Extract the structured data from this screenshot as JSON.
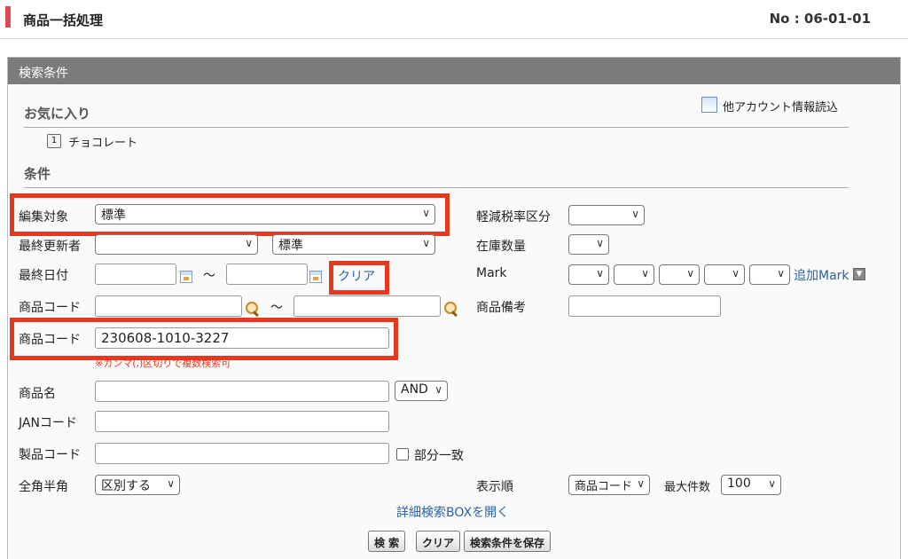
{
  "header": {
    "title": "商品一括処理",
    "page_no": "No : 06-01-01"
  },
  "panel": {
    "title": "検索条件",
    "favorites": {
      "heading": "お気に入り",
      "other_account_link": "他アカウント情報読込",
      "item_badge": "1",
      "item_label": "チョコレート"
    },
    "conditions_heading": "条件",
    "fields": {
      "edit_target": {
        "label": "編集対象",
        "value": "標準"
      },
      "last_updater": {
        "label": "最終更新者",
        "value": "",
        "value2": "標準"
      },
      "last_date": {
        "label": "最終日付",
        "from": "",
        "tilde": "〜",
        "to": "",
        "clear": "クリア"
      },
      "product_code_range": {
        "label": "商品コード",
        "from": "",
        "tilde": "〜",
        "to": ""
      },
      "product_code": {
        "label": "商品コード",
        "value": "230608-1010-3227",
        "note": "※カンマ(,)区切りで複数検索可"
      },
      "product_name": {
        "label": "商品名",
        "value": "",
        "op": "AND"
      },
      "jan_code": {
        "label": "JANコード",
        "value": ""
      },
      "maker_code": {
        "label": "製品コード",
        "value": "",
        "partial_label": "部分一致"
      },
      "width": {
        "label": "全角半角",
        "value": "区別する"
      },
      "tax_class": {
        "label": "軽減税率区分",
        "value": ""
      },
      "stock_qty": {
        "label": "在庫数量",
        "value": ""
      },
      "mark": {
        "label": "Mark",
        "add_link": "追加Mark"
      },
      "product_note": {
        "label": "商品備考",
        "value": ""
      },
      "sort": {
        "label": "表示順",
        "value": "商品コード"
      },
      "max_count": {
        "label": "最大件数",
        "value": "100"
      }
    },
    "detail_link": "詳細検索BOXを開く",
    "buttons": {
      "search": "検 索",
      "clear": "クリア",
      "save": "検索条件を保存"
    }
  }
}
